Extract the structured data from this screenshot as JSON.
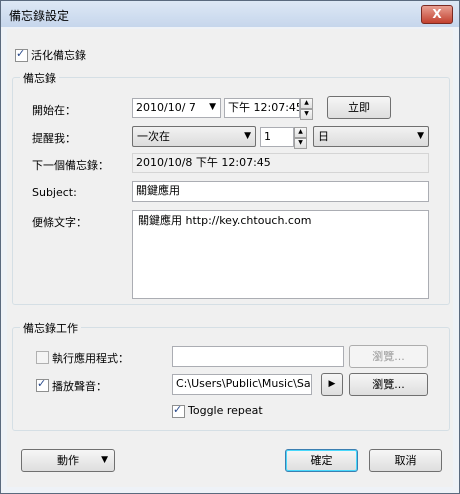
{
  "window": {
    "title": "備忘錄設定",
    "close_glyph": "X"
  },
  "activate": {
    "label": "活化備忘錄",
    "checked": true
  },
  "reminder_group": {
    "title": "備忘錄",
    "start_label": "開始在：",
    "start_date": "2010/10/  7",
    "start_time": "下午 12:07:45",
    "now_button": "立即",
    "remind_label": "提醒我：",
    "remind_mode": "一次在",
    "remind_value": "1",
    "remind_unit": "日",
    "next_label": "下一個備忘錄：",
    "next_value": "2010/10/8 下午 12:07:45",
    "subject_label": "Subject:",
    "subject_value": "關鍵應用",
    "note_label": "便條文字：",
    "note_value": "關鍵應用 http://key.chtouch.com"
  },
  "work_group": {
    "title": "備忘錄工作",
    "run_app_label": "執行應用程式：",
    "run_app_checked": false,
    "run_app_value": "",
    "browse1": "瀏覽...",
    "play_sound_label": "播放聲音：",
    "play_sound_checked": true,
    "sound_path": "C:\\Users\\Public\\Music\\Sam",
    "play_glyph": "▶",
    "browse2": "瀏覽...",
    "toggle_repeat_label": "Toggle repeat",
    "toggle_repeat_checked": true
  },
  "footer": {
    "action": "動作",
    "ok": "確定",
    "cancel": "取消"
  }
}
